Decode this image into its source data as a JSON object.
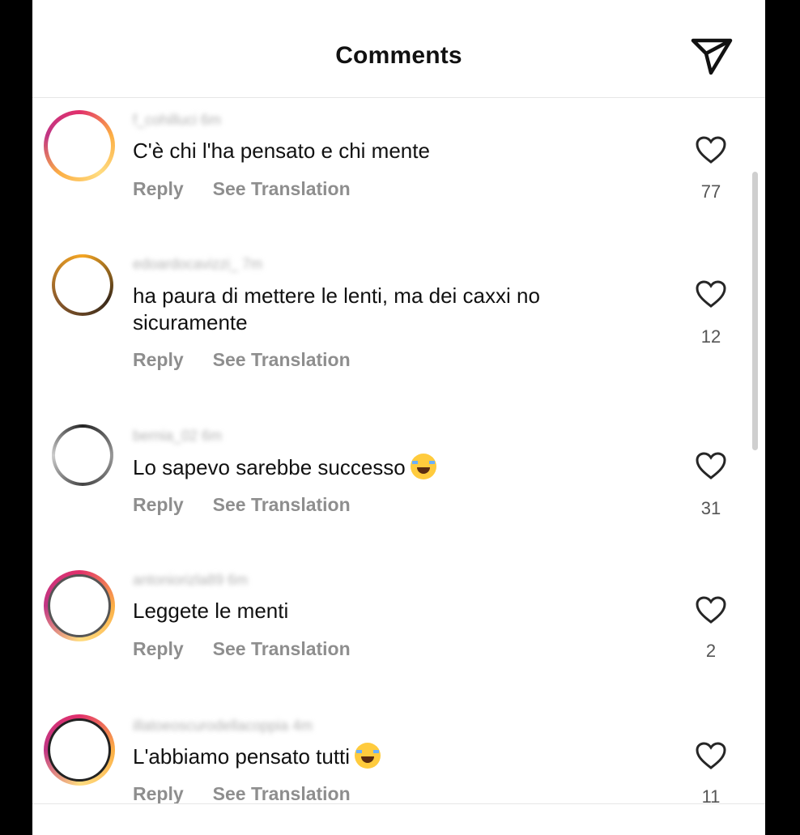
{
  "header": {
    "title": "Comments"
  },
  "actions": {
    "reply": "Reply",
    "see_translation": "See Translation"
  },
  "comments": [
    {
      "username": "f_cohilluci 6m",
      "text": "C'è chi l'ha pensato e chi mente",
      "likes": "77",
      "emoji": false
    },
    {
      "username": "edoardocavizzi_ 7m",
      "text": "ha paura di mettere le lenti, ma dei caxxi no sicuramente",
      "likes": "12",
      "emoji": false
    },
    {
      "username": "bernia_02 6m",
      "text": "Lo sapevo sarebbe successo",
      "likes": "31",
      "emoji": true
    },
    {
      "username": "antoniorizla89 6m",
      "text": "Leggete le menti",
      "likes": "2",
      "emoji": false
    },
    {
      "username": "illatoeoscurodellacoppia 4m",
      "text": "L'abbiamo pensato tutti",
      "likes": "11",
      "emoji": true
    }
  ]
}
